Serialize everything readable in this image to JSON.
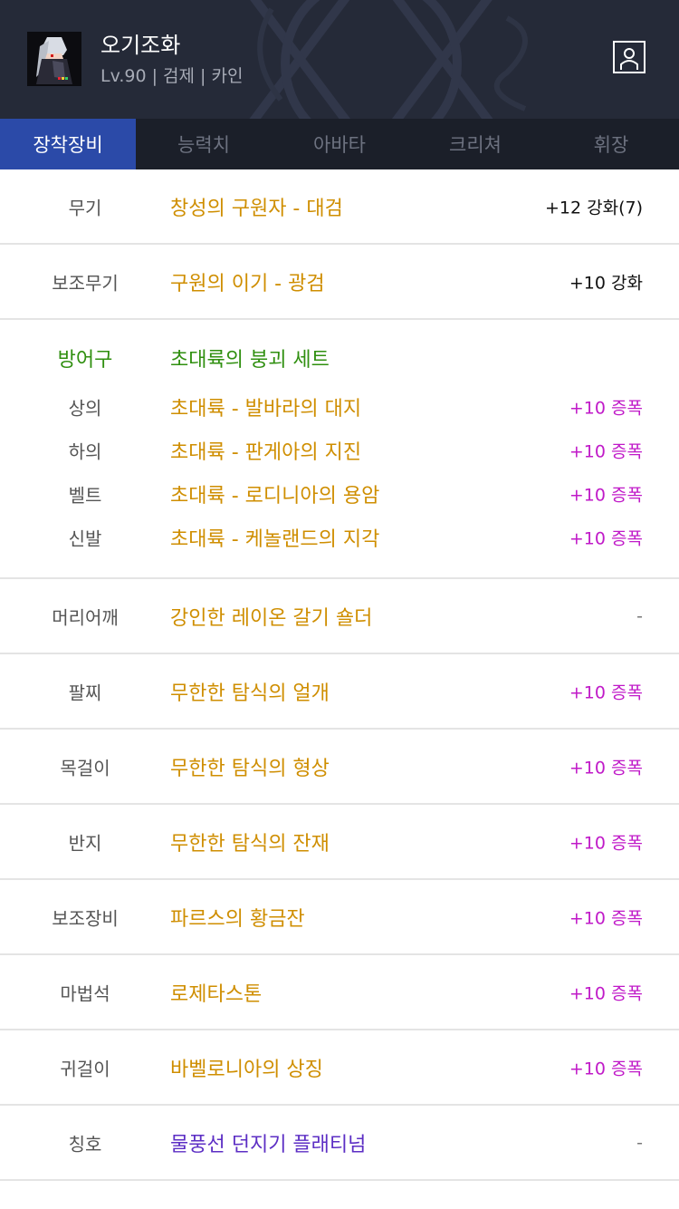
{
  "character": {
    "name": "오기조화",
    "info": "Lv.90 | 검제 | 카인"
  },
  "tabs": [
    "장착장비",
    "능력치",
    "아바타",
    "크리쳐",
    "휘장"
  ],
  "weapon": {
    "slot": "무기",
    "name": "창성의 구원자 - 대검",
    "value": "+12 강화(7)"
  },
  "subweapon": {
    "slot": "보조무기",
    "name": "구원의 이기 - 광검",
    "value": "+10 강화"
  },
  "armor": {
    "label": "방어구",
    "set_name": "초대륙의 붕괴 세트",
    "pieces": [
      {
        "slot": "상의",
        "name": "초대륙 - 발바라의 대지",
        "value": "+10 증폭"
      },
      {
        "slot": "하의",
        "name": "초대륙 - 판게아의 지진",
        "value": "+10 증폭"
      },
      {
        "slot": "벨트",
        "name": "초대륙 - 로디니아의 용암",
        "value": "+10 증폭"
      },
      {
        "slot": "신발",
        "name": "초대륙 - 케놀랜드의 지각",
        "value": "+10 증폭"
      }
    ]
  },
  "accessories": [
    {
      "slot": "머리어깨",
      "name": "강인한 레이온 갈기 숄더",
      "value": "-"
    },
    {
      "slot": "팔찌",
      "name": "무한한 탐식의 얼개",
      "value": "+10 증폭"
    },
    {
      "slot": "목걸이",
      "name": "무한한 탐식의 형상",
      "value": "+10 증폭"
    },
    {
      "slot": "반지",
      "name": "무한한 탐식의 잔재",
      "value": "+10 증폭"
    },
    {
      "slot": "보조장비",
      "name": "파르스의 황금잔",
      "value": "+10 증폭"
    },
    {
      "slot": "마법석",
      "name": "로제타스톤",
      "value": "+10 증폭"
    },
    {
      "slot": "귀걸이",
      "name": "바벨로니아의 상징",
      "value": "+10 증폭"
    }
  ],
  "title_item": {
    "slot": "칭호",
    "name": "물풍선 던지기 플래티넘",
    "value": "-"
  },
  "colors": {
    "header_bg": "#252a38",
    "tab_active": "#2b4aa8",
    "item_orange": "#cf8e00",
    "set_green": "#2f8f0f",
    "amp_magenta": "#c01ac8",
    "title_purple": "#5c2ec4"
  },
  "icons": {
    "profile": "person-card-icon",
    "avatar": "character-portrait"
  }
}
